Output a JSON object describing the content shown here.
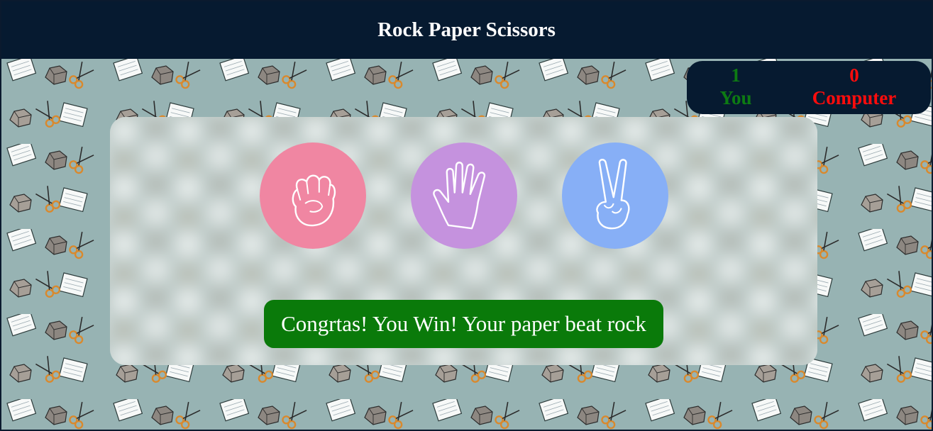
{
  "header": {
    "title": "Rock Paper Scissors"
  },
  "score": {
    "user": {
      "value": "1",
      "label": "You"
    },
    "computer": {
      "value": "0",
      "label": "Computer"
    }
  },
  "choices": [
    {
      "id": "rock",
      "icon": "fist-icon",
      "color": "#f086a2"
    },
    {
      "id": "paper",
      "icon": "open-hand-icon",
      "color": "#c592de"
    },
    {
      "id": "scissors",
      "icon": "peace-hand-icon",
      "color": "#87aff6"
    }
  ],
  "result": {
    "message": "Congrtas! You Win! Your paper beat rock",
    "color": "#0a7a0a"
  },
  "colors": {
    "header_bg": "#061a30",
    "pattern_bg": "#97b3b3",
    "user_score": "#0d7b13",
    "computer_score": "#ff0c0c"
  }
}
